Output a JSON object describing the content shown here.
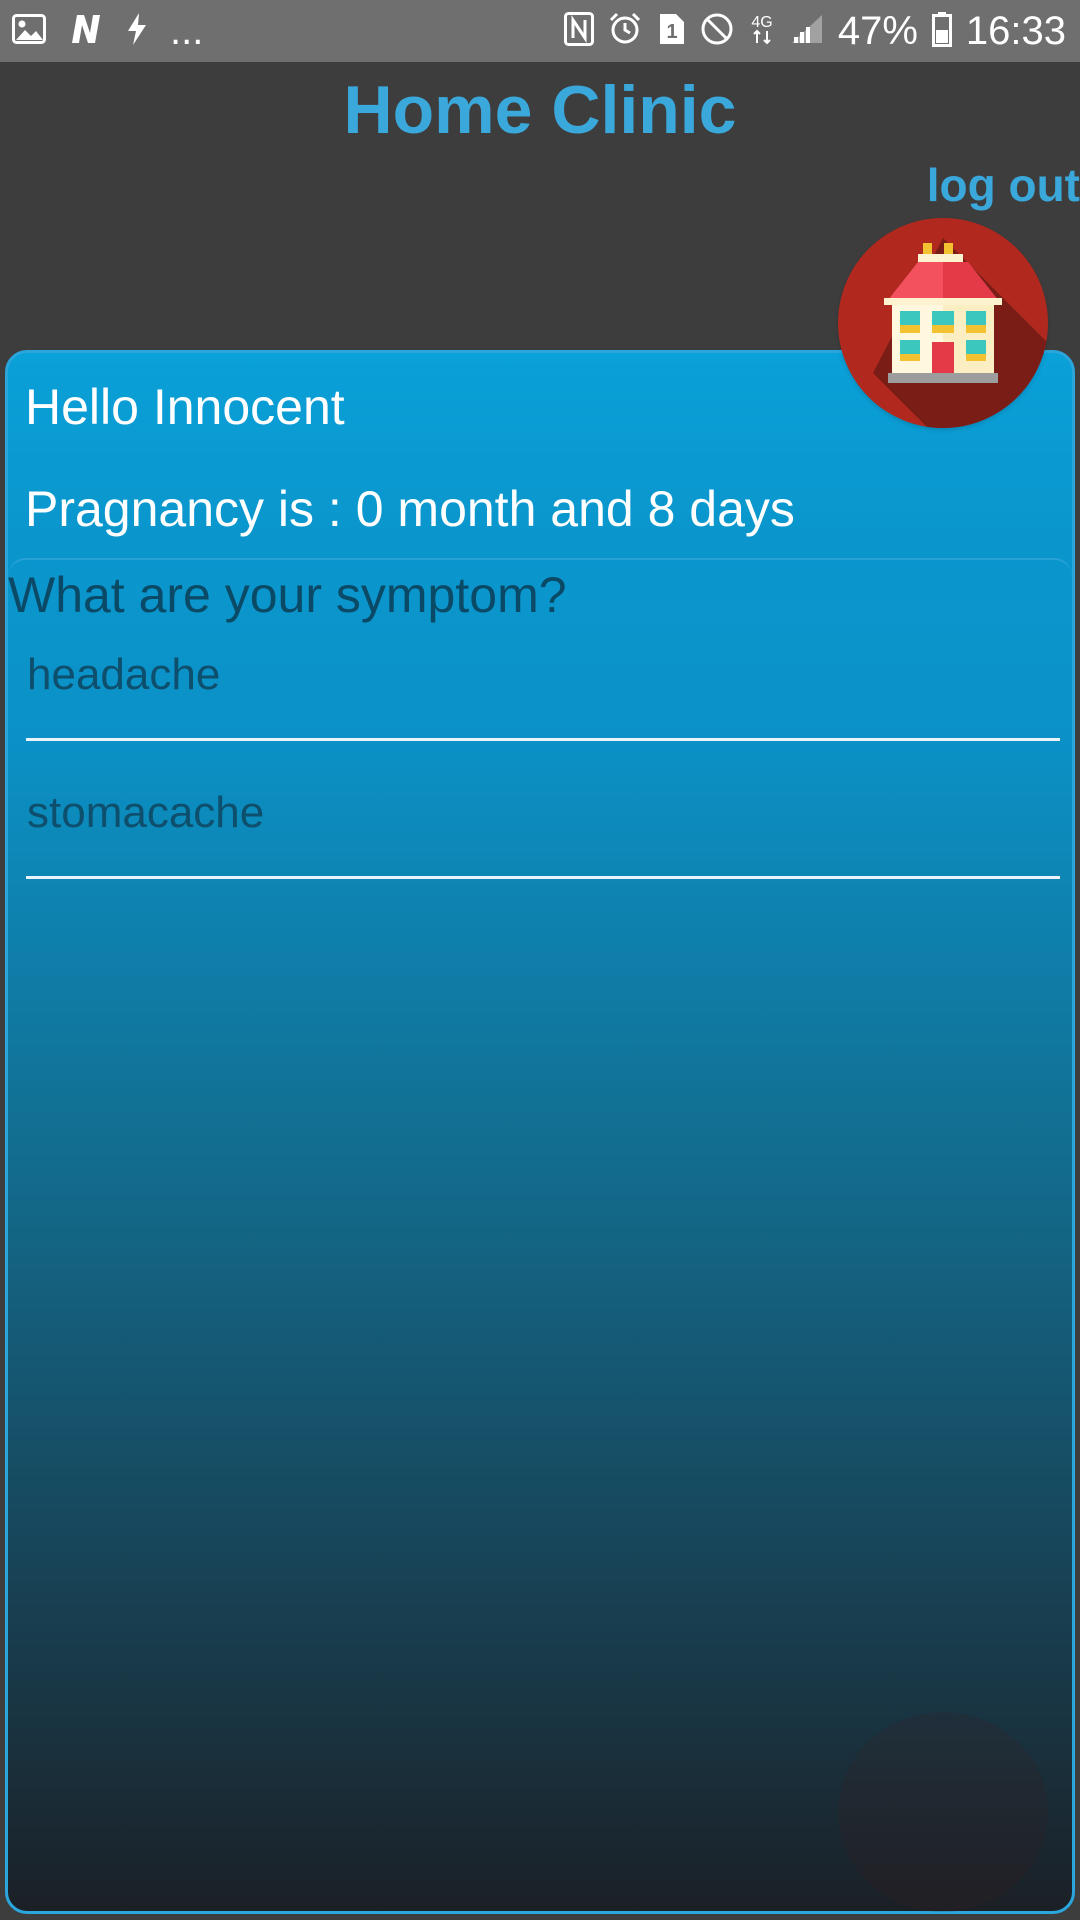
{
  "status_bar": {
    "left_icons": [
      "image-icon",
      "n-app-icon",
      "flash-icon"
    ],
    "overflow": "...",
    "right_icons": [
      "nfc-icon",
      "alarm-icon",
      "sim-1-icon",
      "do-not-disturb-icon",
      "network-4g-icon",
      "signal-icon"
    ],
    "battery": "47%",
    "time": "16:33"
  },
  "header": {
    "title": "Home Clinic",
    "logout_label": "log out",
    "icon": "clinic-building-icon"
  },
  "greeting": {
    "hello": "Hello Innocent",
    "pregnancy": "Pragnancy is : 0 month and 8 days"
  },
  "symptoms": {
    "question": "What are your symptom?",
    "items": [
      {
        "label": "headache"
      },
      {
        "label": "stomacache"
      }
    ]
  },
  "colors": {
    "accent": "#3aa8db",
    "card_top": "#0a9dd6",
    "card_bottom": "#1b2026",
    "text_dark": "#0d4f6c"
  }
}
